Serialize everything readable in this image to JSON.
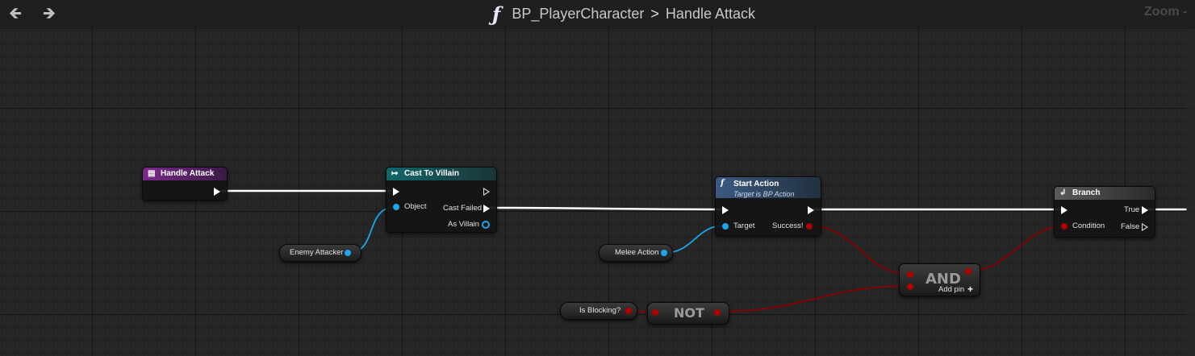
{
  "toolbar": {
    "back_icon": "arrow-left-icon",
    "forward_icon": "arrow-right-icon",
    "function_icon": "ƒ",
    "blueprint_name": "BP_PlayerCharacter",
    "separator": ">",
    "graph_name": "Handle Attack",
    "zoom_label": "Zoom -"
  },
  "nodes": {
    "handle_attack": {
      "title": "Handle Attack",
      "color": "#7a2a8a"
    },
    "cast_to_villain": {
      "title": "Cast To Villain",
      "color": "#12676b",
      "object_label": "Object",
      "cast_failed_label": "Cast Failed",
      "as_villain_label": "As Villain"
    },
    "start_action": {
      "title": "Start Action",
      "subtitle": "Target is BP Action",
      "color": "#3b5a82",
      "target_label": "Target",
      "success_label": "Success!"
    },
    "branch": {
      "title": "Branch",
      "color": "#4f4f4f",
      "condition_label": "Condition",
      "true_label": "True",
      "false_label": "False"
    },
    "and": {
      "label": "AND",
      "add_pin_label": "Add pin",
      "add_pin_icon": "+"
    },
    "not": {
      "label": "NOT"
    }
  },
  "variables": {
    "enemy_attacker": "Enemy Attacker",
    "melee_action": "Melee Action",
    "is_blocking": "Is Blocking?"
  },
  "colors": {
    "exec_wire": "#ffffff",
    "object_wire": "#1aa7ec",
    "bool_wire": "#8a0000"
  }
}
